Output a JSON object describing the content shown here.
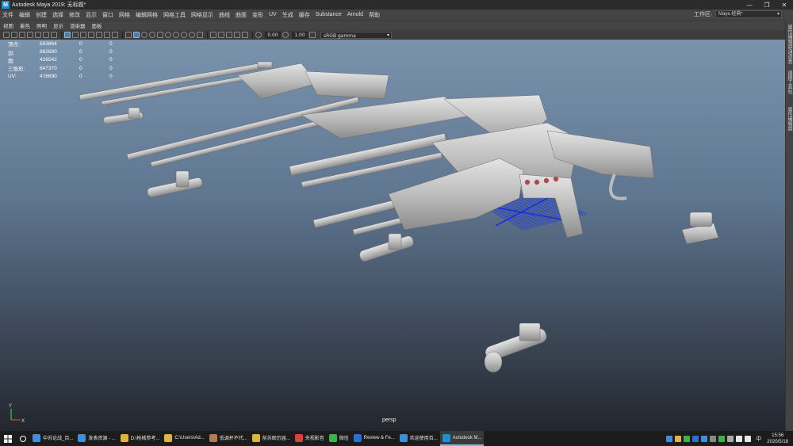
{
  "window": {
    "title": "Autodesk Maya 2019: 无标题*",
    "logo_letter": "M",
    "controls": [
      "—",
      "❐",
      "✕"
    ]
  },
  "menu": [
    "文件",
    "编辑",
    "创建",
    "选择",
    "修改",
    "显示",
    "窗口",
    "网格",
    "编辑网格",
    "网格工具",
    "网格显示",
    "曲线",
    "曲面",
    "变形",
    "UV",
    "生成",
    "缓存",
    "Substance",
    "Arnold",
    "帮助"
  ],
  "workspace": {
    "label": "工作区:",
    "value": "Maya 经典*"
  },
  "panel_menu": [
    "视图",
    "着色",
    "照明",
    "显示",
    "渲染器",
    "面板"
  ],
  "toolbar": {
    "value1": "0.00",
    "value2": "1.00",
    "colorspace": "sRGB gamma"
  },
  "hud": {
    "rows": [
      [
        "顶点:",
        "693864",
        "0",
        "0"
      ],
      [
        "边:",
        "862680",
        "0",
        "0"
      ],
      [
        "面:",
        "426542",
        "0",
        "0"
      ],
      [
        "三角形:",
        "847370",
        "0",
        "0"
      ],
      [
        "UV:",
        "478690",
        "0",
        "0"
      ]
    ]
  },
  "viewport": {
    "camera": "persp",
    "axis_x": "X",
    "axis_y": "Y"
  },
  "right_tabs": [
    "属性编辑器/通道盒",
    "建模工具包",
    "属性编辑器"
  ],
  "taskbar": {
    "apps": [
      {
        "label": "中苏论战_百...",
        "color": "#3d8fd9"
      },
      {
        "label": "发表资源 - ...",
        "color": "#3d8fd9"
      },
      {
        "label": "D:\\枪械参考...",
        "color": "#e0b340"
      },
      {
        "label": "C:\\Users\\Ad...",
        "color": "#e0b340"
      },
      {
        "label": "低调并不代...",
        "color": "#b07a55"
      },
      {
        "label": "前苏联历届...",
        "color": "#e0b340"
      },
      {
        "label": "央视影音",
        "color": "#d9433b"
      },
      {
        "label": "微信",
        "color": "#3bb34a"
      },
      {
        "label": "Review & Fe...",
        "color": "#2b6fd6"
      },
      {
        "label": "欢迎使用百...",
        "color": "#3d8fd9"
      },
      {
        "label": "Autodesk M...",
        "color": "#1e8fd6"
      }
    ],
    "ime": "中",
    "time": "15:56",
    "date": "2020/5/18"
  },
  "colors": {
    "viewport_top": "#7a93ad",
    "viewport_bottom": "#23272d",
    "grid": "#3050d8",
    "accent": "#4f7dab"
  }
}
